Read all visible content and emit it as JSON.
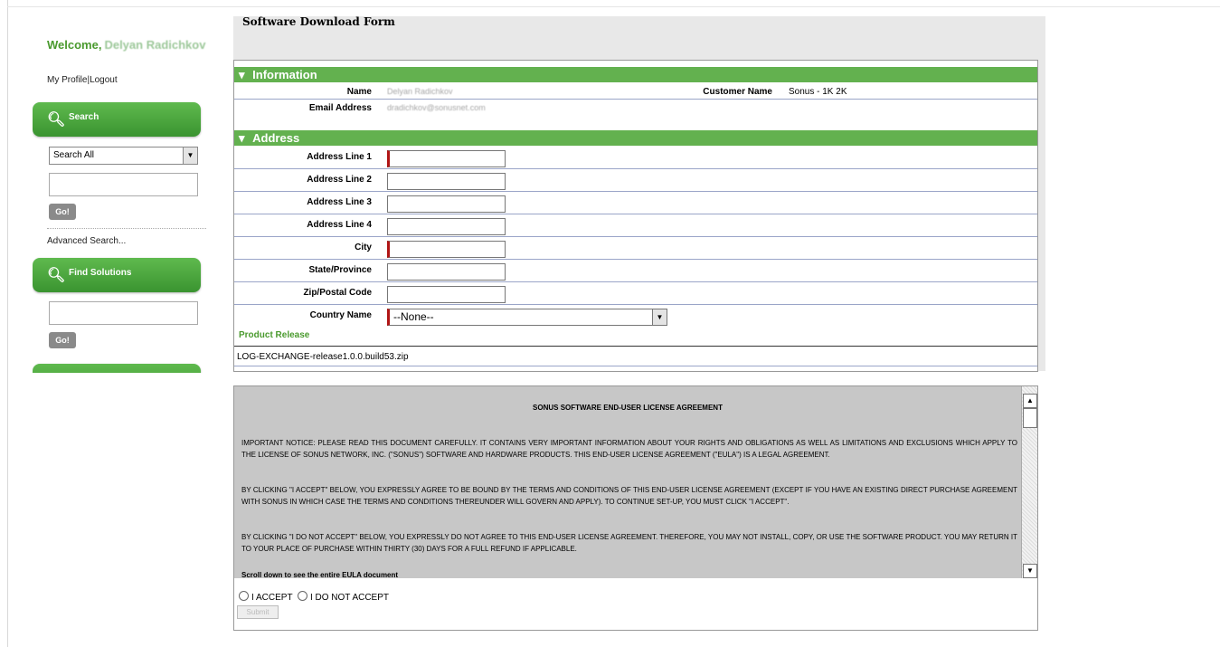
{
  "sidebar": {
    "welcome_prefix": "Welcome,",
    "username": "Delyan Radichkov",
    "my_profile": "My Profile",
    "separator": "|",
    "logout": "Logout",
    "search_button": "Search",
    "search_select": "Search All",
    "go_label": "Go!",
    "advanced_search": "Advanced Search...",
    "find_solutions_button": "Find Solutions"
  },
  "form": {
    "title": "Software Download Form",
    "information_header": "Information",
    "name_label": "Name",
    "name_value": "Delyan Radichkov",
    "customer_name_label": "Customer Name",
    "customer_name_value": "Sonus - 1K 2K",
    "email_label": "Email Address",
    "email_value": "dradichkov@sonusnet.com",
    "address_header": "Address",
    "fields": [
      {
        "label": "Address Line 1",
        "required": true
      },
      {
        "label": "Address Line 2",
        "required": false
      },
      {
        "label": "Address Line 3",
        "required": false
      },
      {
        "label": "Address Line 4",
        "required": false
      },
      {
        "label": "City",
        "required": true
      },
      {
        "label": "State/Province",
        "required": false
      },
      {
        "label": "Zip/Postal Code",
        "required": false
      }
    ],
    "country_label": "Country Name",
    "country_value": "--None--",
    "product_release_header": "Product Release",
    "product_release_file": "LOG-EXCHANGE-release1.0.0.build53.zip"
  },
  "eula": {
    "title": "SONUS SOFTWARE END-USER LICENSE AGREEMENT",
    "p1": "IMPORTANT NOTICE: PLEASE READ THIS DOCUMENT CAREFULLY. IT CONTAINS VERY IMPORTANT INFORMATION ABOUT YOUR RIGHTS AND OBLIGATIONS AS WELL AS LIMITATIONS AND EXCLUSIONS WHICH APPLY TO THE LICENSE OF SONUS NETWORK, INC. (\"SONUS\") SOFTWARE AND HARDWARE PRODUCTS. THIS END-USER LICENSE AGREEMENT (\"EULA\") IS A LEGAL AGREEMENT.",
    "p2": "BY CLICKING \"I ACCEPT\" BELOW, YOU EXPRESSLY AGREE TO BE BOUND BY THE TERMS AND CONDITIONS OF THIS END-USER LICENSE AGREEMENT (EXCEPT IF YOU HAVE AN EXISTING DIRECT PURCHASE AGREEMENT WITH SONUS IN WHICH CASE THE TERMS AND CONDITIONS THEREUNDER WILL GOVERN AND APPLY). TO CONTINUE SET-UP, YOU MUST CLICK \"I ACCEPT\".",
    "p3": "BY CLICKING \"I DO NOT ACCEPT\" BELOW, YOU EXPRESSLY DO NOT AGREE TO THIS END-USER LICENSE AGREEMENT. THEREFORE, YOU MAY NOT INSTALL, COPY, OR USE THE SOFTWARE PRODUCT. YOU MAY RETURN IT TO YOUR PLACE OF PURCHASE WITHIN THIRTY (30) DAYS FOR A FULL REFUND IF APPLICABLE.",
    "scroll_note": "Scroll down to see the entire EULA document",
    "accept_label": "I ACCEPT",
    "decline_label": "I DO NOT ACCEPT",
    "submit_label": "Submit"
  },
  "icons": {
    "search": "magnifier-icon",
    "dropdown": "triangle-down-icon"
  }
}
